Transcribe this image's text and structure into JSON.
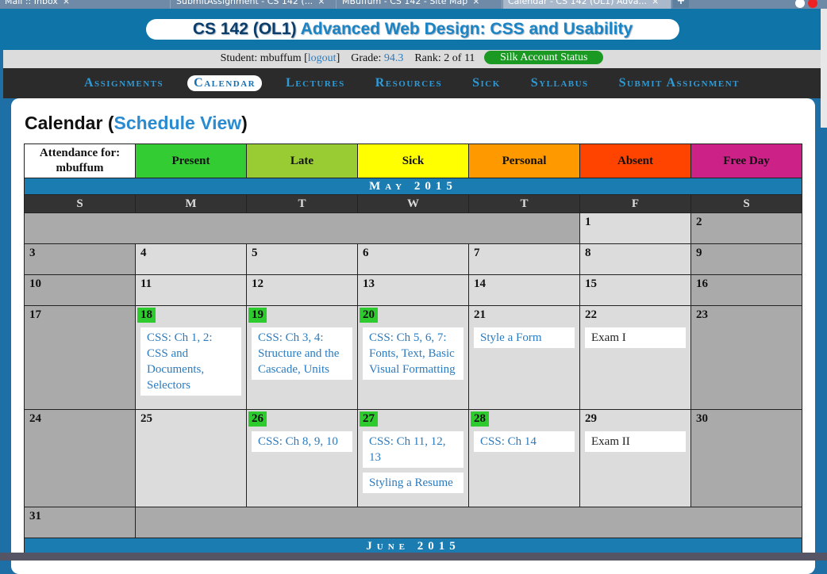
{
  "browser": {
    "tabs": [
      {
        "label": "Mail :: Inbox"
      },
      {
        "label": "SubmitAssignment - CS 142 (..."
      },
      {
        "label": "MBuffum - CS 142 - Site Map"
      },
      {
        "label": "Calendar - CS 142 (OL1) Adva..."
      }
    ]
  },
  "header": {
    "course_code": "CS 142 (OL1)",
    "course_title": "Advanced Web Design: CSS and Usability"
  },
  "student": {
    "student_label": "Student: mbuffum",
    "logout": "logout",
    "grade_label": "Grade:",
    "grade": "94.3",
    "rank": "Rank: 2 of 11",
    "silk": "Silk Account Status"
  },
  "nav": [
    {
      "label": "Assignments"
    },
    {
      "label": "Calendar"
    },
    {
      "label": "Lectures"
    },
    {
      "label": "Resources"
    },
    {
      "label": "Sick"
    },
    {
      "label": "Syllabus"
    },
    {
      "label": "Submit Assignment"
    }
  ],
  "page": {
    "title": "Calendar",
    "view_link": "Schedule View"
  },
  "legend": {
    "attendance_for": "Attendance for:",
    "user": "mbuffum",
    "items": [
      {
        "label": "Present",
        "color": "#33cc33"
      },
      {
        "label": "Late",
        "color": "#99cc33"
      },
      {
        "label": "Sick",
        "color": "#ffff00"
      },
      {
        "label": "Personal",
        "color": "#ff9900"
      },
      {
        "label": "Absent",
        "color": "#ff4400"
      },
      {
        "label": "Free Day",
        "color": "#cc2288"
      }
    ]
  },
  "calendar": {
    "month": "May 2015",
    "next_month": "June 2015",
    "days_of_week": [
      "S",
      "M",
      "T",
      "W",
      "T",
      "F",
      "S"
    ],
    "days": {
      "d1": "1",
      "d2": "2",
      "d3": "3",
      "d4": "4",
      "d5": "5",
      "d6": "6",
      "d7": "7",
      "d8": "8",
      "d9": "9",
      "d10": "10",
      "d11": "11",
      "d12": "12",
      "d13": "13",
      "d14": "14",
      "d15": "15",
      "d16": "16",
      "d17": "17",
      "d18": "18",
      "d19": "19",
      "d20": "20",
      "d21": "21",
      "d22": "22",
      "d23": "23",
      "d24": "24",
      "d25": "25",
      "d26": "26",
      "d27": "27",
      "d28": "28",
      "d29": "29",
      "d30": "30",
      "d31": "31"
    },
    "events": {
      "e18": "CSS: Ch 1, 2: CSS and Documents, Selectors",
      "e19": "CSS: Ch 3, 4: Structure and the Cascade, Units",
      "e20": "CSS: Ch 5, 6, 7: Fonts, Text, Basic Visual Formatting",
      "e21": "Style a Form",
      "e22": "Exam I",
      "e26": "CSS: Ch 8, 9, 10",
      "e27a": "CSS: Ch 11, 12, 13",
      "e27b": "Styling a Resume",
      "e28": "CSS: Ch 14",
      "e29": "Exam II"
    }
  }
}
